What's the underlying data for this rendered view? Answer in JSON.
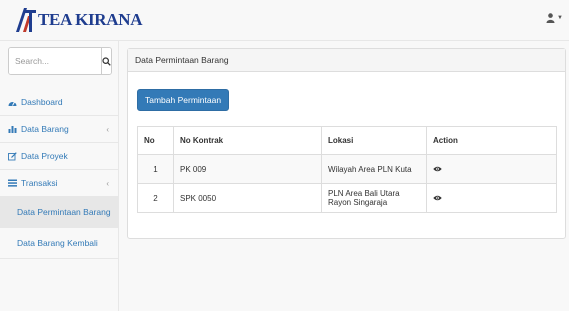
{
  "brand": {
    "name": "TEA KIRANA"
  },
  "user_menu": {
    "icon": "user-icon"
  },
  "sidebar": {
    "search": {
      "placeholder": "Search...",
      "icon": "search-icon"
    },
    "items": [
      {
        "label": "Dashboard",
        "icon": "dashboard-icon"
      },
      {
        "label": "Data Barang",
        "icon": "bar-chart-icon",
        "has_submenu": true
      },
      {
        "label": "Data Proyek",
        "icon": "edit-icon"
      },
      {
        "label": "Transaksi",
        "icon": "list-icon",
        "has_submenu": true
      }
    ],
    "subitems": [
      {
        "label": "Data Permintaan Barang",
        "active": true
      },
      {
        "label": "Data Barang Kembali",
        "active": false
      }
    ]
  },
  "main": {
    "panel_title": "Data Permintaan Barang",
    "add_button": "Tambah Permintaan",
    "table": {
      "columns": [
        "No",
        "No Kontrak",
        "Lokasi",
        "Action"
      ],
      "rows": [
        {
          "no": "1",
          "kontrak": "PK 009",
          "lokasi": "Wilayah Area PLN Kuta",
          "action": "view-icon"
        },
        {
          "no": "2",
          "kontrak": "SPK 0050",
          "lokasi": "PLN Area Bali Utara Rayon Singaraja",
          "action": "view-icon"
        }
      ]
    }
  },
  "colors": {
    "brand": "#1f3d8f",
    "logo_accent": "#c0392b",
    "primary": "#337ab7"
  }
}
